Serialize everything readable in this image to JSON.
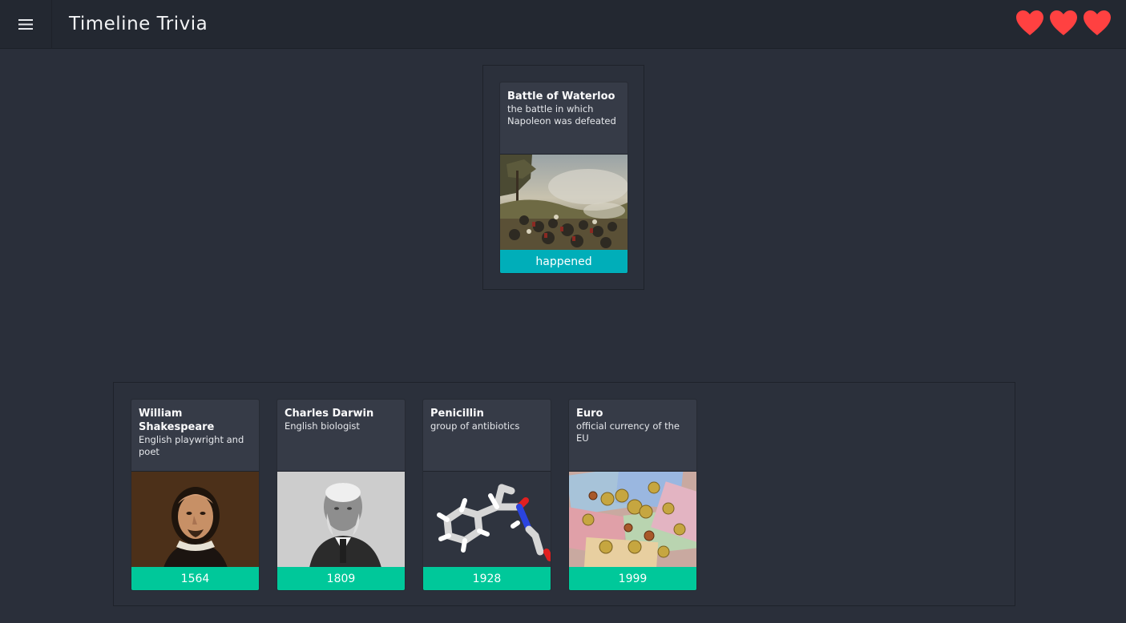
{
  "header": {
    "title": "Timeline Trivia",
    "menu_icon": "hamburger-menu-icon",
    "lives": 3,
    "heart_color": "#ff4141"
  },
  "current_card": {
    "title": "Battle of Waterloo",
    "description": "the battle in which Napoleon was defeated",
    "footer": "happened",
    "footer_color": "#00aeb9"
  },
  "timeline": {
    "cards": [
      {
        "title": "William Shakespeare",
        "description": "English playwright and poet",
        "year": "1564"
      },
      {
        "title": "Charles Darwin",
        "description": "English biologist",
        "year": "1809"
      },
      {
        "title": "Penicillin",
        "description": "group of antibiotics",
        "year": "1928"
      },
      {
        "title": "Euro",
        "description": "official currency of the EU",
        "year": "1999"
      }
    ],
    "footer_color": "#00c89a"
  }
}
